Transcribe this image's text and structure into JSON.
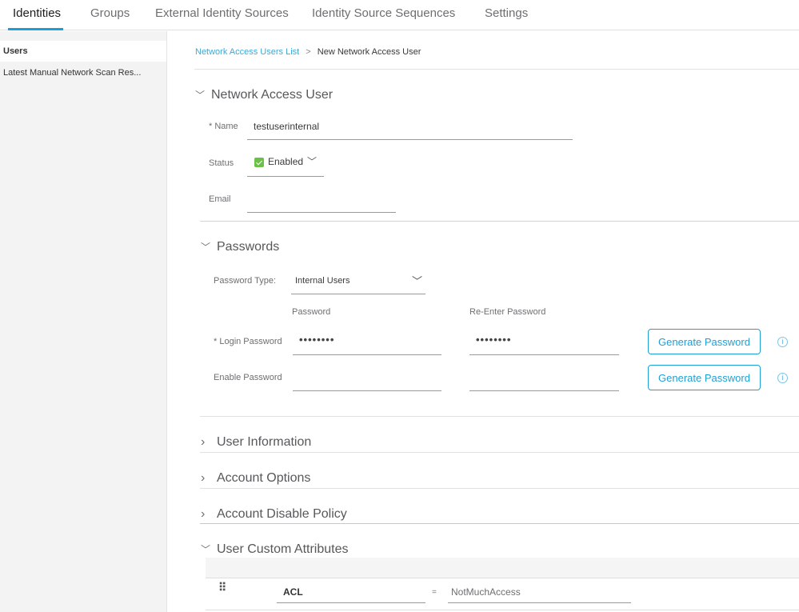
{
  "tabs": [
    {
      "label": "Identities",
      "active": true
    },
    {
      "label": "Groups",
      "active": false
    },
    {
      "label": "External Identity Sources",
      "active": false
    },
    {
      "label": "Identity Source Sequences",
      "active": false
    },
    {
      "label": "Settings",
      "active": false
    }
  ],
  "sidebar": {
    "items": [
      {
        "label": "Users",
        "selected": true
      },
      {
        "label": "Latest Manual Network Scan Res...",
        "selected": false
      }
    ]
  },
  "breadcrumb": {
    "link": "Network Access Users List",
    "separator": ">",
    "current": "New Network Access User"
  },
  "network_access_user": {
    "title": "Network Access User",
    "expanded": true,
    "name_label": "* Name",
    "name_value": "testuserinternal",
    "status_label": "Status",
    "status_value": "Enabled",
    "status_checked": true,
    "email_label": "Email",
    "email_value": ""
  },
  "passwords": {
    "title": "Passwords",
    "expanded": true,
    "password_type_label": "Password Type:",
    "password_type_value": "Internal Users",
    "col_password": "Password",
    "col_reenter": "Re-Enter Password",
    "login_label": "* Login Password",
    "login_value": "••••••••",
    "login_reenter_value": "••••••••",
    "enable_label": "Enable Password",
    "enable_value": "",
    "enable_reenter_value": "",
    "generate_label": "Generate Password",
    "info_glyph": "i"
  },
  "collapsed_sections": [
    {
      "title": "User Information",
      "expanded": false
    },
    {
      "title": "Account Options",
      "expanded": false
    },
    {
      "title": "Account Disable Policy",
      "expanded": false
    }
  ],
  "custom_attributes": {
    "title": "User Custom Attributes",
    "expanded": true,
    "rows": [
      {
        "name": "ACL",
        "operator": "=",
        "value": "NotMuchAccess"
      }
    ]
  },
  "icons": {
    "chevron_down": "﹀",
    "chevron_right": "›",
    "drag_handle": "⠿"
  },
  "colors": {
    "accent": "#1aa0d6",
    "link": "#3ea9d4",
    "checkbox_green": "#6cc04a"
  }
}
